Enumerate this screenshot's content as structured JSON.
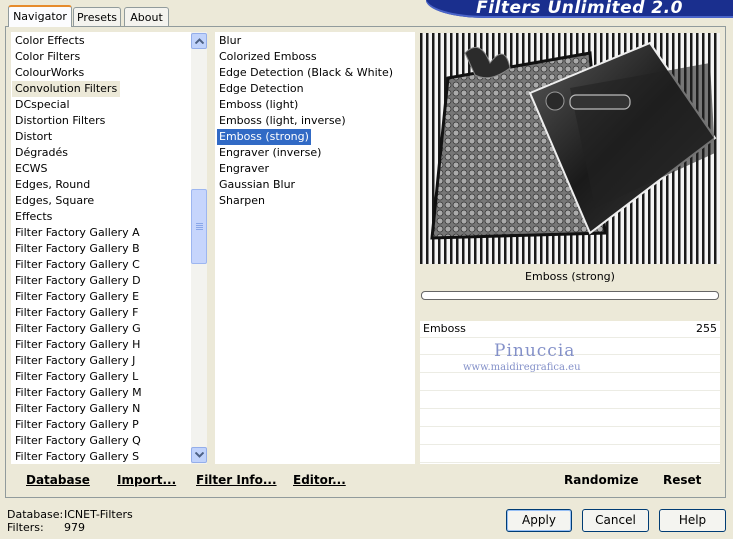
{
  "app": {
    "title": "Filters Unlimited 2.0"
  },
  "tabs": [
    {
      "label": "Navigator",
      "active": true
    },
    {
      "label": "Presets",
      "active": false
    },
    {
      "label": "About",
      "active": false
    }
  ],
  "categories": {
    "items": [
      "Color Effects",
      "Color Filters",
      "ColourWorks",
      "Convolution Filters",
      "DCspecial",
      "Distortion Filters",
      "Distort",
      "Dégradés",
      "ECWS",
      "Edges, Round",
      "Edges, Square",
      "Effects",
      "Filter Factory Gallery A",
      "Filter Factory Gallery B",
      "Filter Factory Gallery C",
      "Filter Factory Gallery D",
      "Filter Factory Gallery E",
      "Filter Factory Gallery F",
      "Filter Factory Gallery G",
      "Filter Factory Gallery H",
      "Filter Factory Gallery J",
      "Filter Factory Gallery L",
      "Filter Factory Gallery M",
      "Filter Factory Gallery N",
      "Filter Factory Gallery P",
      "Filter Factory Gallery Q",
      "Filter Factory Gallery S"
    ],
    "selected": "Convolution Filters"
  },
  "filters": {
    "items": [
      "Blur",
      "Colorized Emboss",
      "Edge Detection (Black & White)",
      "Edge Detection",
      "Emboss (light)",
      "Emboss (light, inverse)",
      "Emboss (strong)",
      "Engraver (inverse)",
      "Engraver",
      "Gaussian Blur",
      "Sharpen"
    ],
    "selected": "Emboss (strong)"
  },
  "toolbar": {
    "database": "Database",
    "import": "Import...",
    "filter_info": "Filter Info...",
    "editor": "Editor..."
  },
  "preview": {
    "filter_name": "Emboss (strong)",
    "watermark": "Pinuccia",
    "watermark_url": "www.maidiregrafica.eu"
  },
  "params": [
    {
      "name": "Emboss",
      "value": "255"
    }
  ],
  "actions": {
    "randomize": "Randomize",
    "reset": "Reset"
  },
  "status": {
    "database_label": "Database:",
    "database_value": "ICNET-Filters",
    "filters_label": "Filters:",
    "filters_value": "979"
  },
  "buttons": {
    "apply": "Apply",
    "cancel": "Cancel",
    "help": "Help"
  },
  "colors": {
    "selection": "#316ac5",
    "banner": "#1a2f8e",
    "tab_accent": "#e68b2c",
    "window_bg": "#ece9d8"
  }
}
